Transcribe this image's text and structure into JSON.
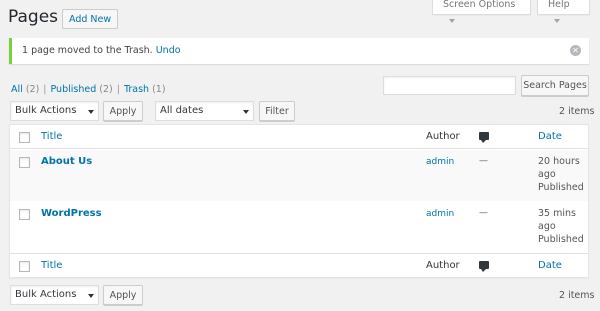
{
  "header": {
    "title": "Pages",
    "add_new": "Add New",
    "screen_options": "Screen Options",
    "help": "Help"
  },
  "notice": {
    "message": "1 page moved to the Trash.",
    "undo": "Undo",
    "accent_color": "#7ad03a"
  },
  "filters": [
    {
      "label": "All",
      "count": "(2)"
    },
    {
      "label": "Published",
      "count": "(2)"
    },
    {
      "label": "Trash",
      "count": "(1)"
    }
  ],
  "search": {
    "value": "",
    "button": "Search Pages"
  },
  "tablenav_top": {
    "bulk_actions": "Bulk Actions",
    "apply": "Apply",
    "dates": "All dates",
    "filter": "Filter",
    "items": "2 items"
  },
  "columns": {
    "title": "Title",
    "author": "Author",
    "comments_icon": "comment-bubble-icon",
    "date": "Date"
  },
  "rows": [
    {
      "title": "About Us",
      "author": "admin",
      "comments": "—",
      "date_line1": "20 hours",
      "date_line2": "ago",
      "status": "Published"
    },
    {
      "title": "WordPress",
      "author": "admin",
      "comments": "—",
      "date_line1": "35 mins",
      "date_line2": "ago",
      "status": "Published"
    }
  ],
  "tablenav_bottom": {
    "bulk_actions": "Bulk Actions",
    "apply": "Apply",
    "items": "2 items"
  },
  "colors": {
    "link": "#0073aa",
    "background": "#f1f1f1"
  }
}
